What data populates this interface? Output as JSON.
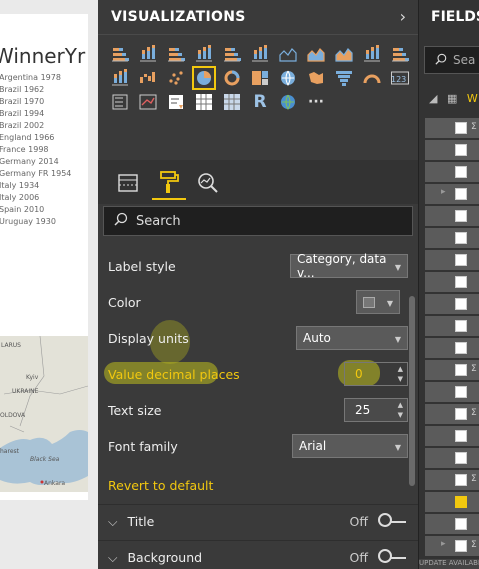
{
  "report": {
    "title": "WinnerYr",
    "winners": [
      "Argentina 1978",
      "Brazil 1962",
      "Brazil 1970",
      "Brazil 1994",
      "Brazil 2002",
      "England 1966",
      "France 1998",
      "Germany 2014",
      "Germany FR 1954",
      "Italy 1934",
      "Italy 2006",
      "Spain 2010",
      "Uruguay 1930"
    ],
    "map_labels": {
      "belarus": "LARUS",
      "kyiv": "Kyiv",
      "ukraine": "UKRAINE",
      "moldova": "OLDOVA",
      "bucharest": "harest",
      "black_sea": "Black Sea",
      "ankara": "Ankara"
    }
  },
  "visualizations": {
    "title": "VISUALIZATIONS",
    "chevron": "›",
    "search_placeholder": "Search",
    "properties": {
      "label_style": {
        "label": "Label style",
        "value": "Category, data v..."
      },
      "color": {
        "label": "Color"
      },
      "display_units": {
        "label": "Display units",
        "value": "Auto"
      },
      "value_decimal_places": {
        "label": "Value decimal places",
        "value": "0"
      },
      "text_size": {
        "label": "Text size",
        "value": "25"
      },
      "font_family": {
        "label": "Font family",
        "value": "Arial"
      }
    },
    "revert_label": "Revert to default",
    "sections": [
      {
        "label": "Title",
        "state": "Off"
      },
      {
        "label": "Background",
        "state": "Off"
      }
    ],
    "icons": [
      "stacked-bar-icon",
      "stacked-column-icon",
      "clustered-bar-icon",
      "clustered-column-icon",
      "100-bar-icon",
      "100-column-icon",
      "line-chart-icon",
      "area-chart-icon",
      "stacked-area-icon",
      "line-column-icon",
      "line-clustered-icon",
      "ribbon-chart-icon",
      "waterfall-icon",
      "scatter-icon",
      "pie-icon",
      "donut-icon",
      "treemap-icon",
      "map-icon",
      "filled-map-icon",
      "funnel-icon",
      "gauge-icon",
      "card-icon",
      "multirow-card-icon",
      "kpi-icon",
      "slicer-icon",
      "table-icon",
      "matrix-icon",
      "r-visual-icon",
      "globe-icon",
      "more-icon"
    ],
    "more_glyph": "···",
    "r_glyph": "R",
    "card_glyph": "123"
  },
  "fields": {
    "title": "FIELDS",
    "search_placeholder": "Sea",
    "table_name": "W",
    "bottom_text": "UPDATE AVAILABLE"
  },
  "colors": {
    "accent": "#f2c80f",
    "pane_bg": "#3a3a3a",
    "highlight": "#bebe1e"
  }
}
